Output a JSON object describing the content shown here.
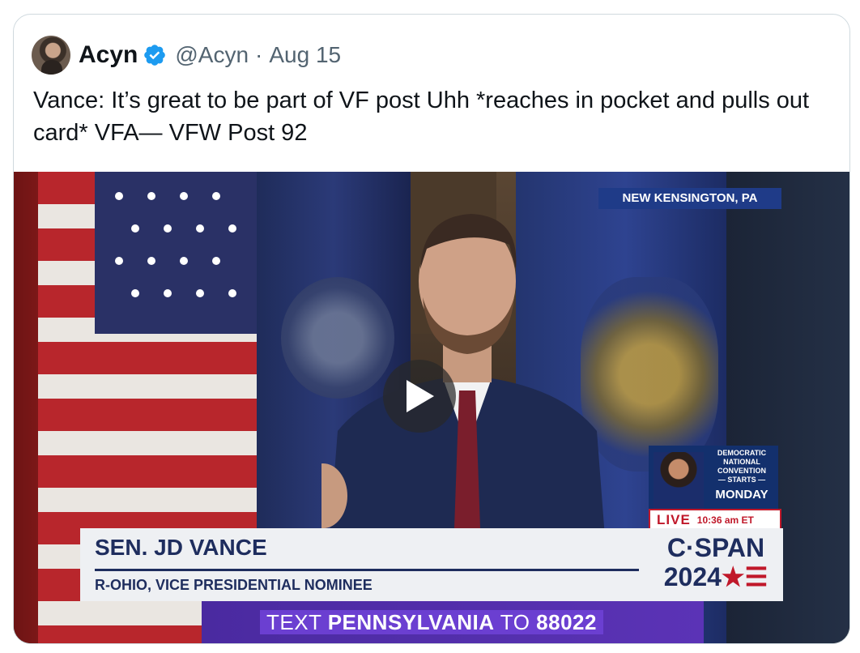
{
  "tweet": {
    "author_name": "Acyn",
    "handle": "@Acyn",
    "separator": "·",
    "date": "Aug 15",
    "text": "Vance: It’s great to be part of VF post Uhh *reaches in pocket and pulls out card* VFA— VFW Post 92"
  },
  "video": {
    "location": "NEW KENSINGTON, PA",
    "dnc_promo": {
      "lines": [
        "DEMOCRATIC",
        "NATIONAL",
        "CONVENTION",
        "— STARTS —"
      ],
      "day": "MONDAY"
    },
    "live_label": "LIVE",
    "live_time": "10:36 am ET",
    "lower_third": {
      "name": "SEN. JD VANCE",
      "title": "R-OHIO, VICE PRESIDENTIAL NOMINEE"
    },
    "network": {
      "name": "C·SPAN",
      "year": "2024",
      "mark": "★☰"
    },
    "banner": {
      "prefix": "TEXT ",
      "keyword": "PENNSYLVANIA",
      "middle": " TO ",
      "number": "88022"
    },
    "play_icon": "play-icon"
  },
  "colors": {
    "verified_blue": "#1d9bf0",
    "text_primary": "#0f1419",
    "text_secondary": "#536471",
    "cspan_navy": "#1e2d5e",
    "live_red": "#c0182a"
  }
}
